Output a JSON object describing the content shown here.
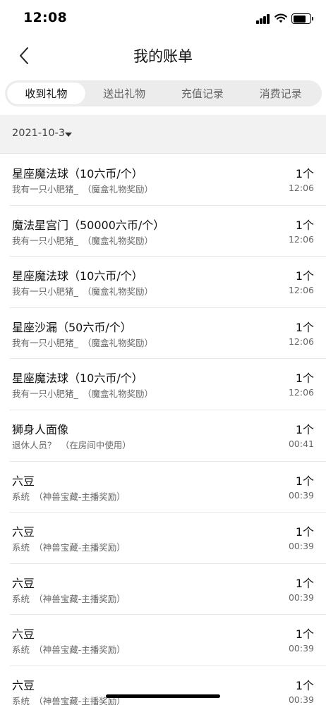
{
  "status_bar": {
    "time": "12:08"
  },
  "header": {
    "title": "我的账单"
  },
  "tabs": [
    {
      "label": "收到礼物",
      "active": true
    },
    {
      "label": "送出礼物",
      "active": false
    },
    {
      "label": "充值记录",
      "active": false
    },
    {
      "label": "消费记录",
      "active": false
    }
  ],
  "date_filter": {
    "value": "2021-10-3"
  },
  "records": [
    {
      "title": "星座魔法球（10六币/个）",
      "subtitle": "我有一只小肥猪_　（魔盒礼物奖励）",
      "count": "1个",
      "time": "12:06"
    },
    {
      "title": "魔法星宫门（50000六币/个）",
      "subtitle": "我有一只小肥猪_　（魔盒礼物奖励）",
      "count": "1个",
      "time": "12:06"
    },
    {
      "title": "星座魔法球（10六币/个）",
      "subtitle": "我有一只小肥猪_　（魔盒礼物奖励）",
      "count": "1个",
      "time": "12:06"
    },
    {
      "title": "星座沙漏（50六币/个）",
      "subtitle": "我有一只小肥猪_　（魔盒礼物奖励）",
      "count": "1个",
      "time": "12:06"
    },
    {
      "title": "星座魔法球（10六币/个）",
      "subtitle": "我有一只小肥猪_　（魔盒礼物奖励）",
      "count": "1个",
      "time": "12:06"
    },
    {
      "title": "狮身人面像",
      "subtitle": "退休人员？　（在房间中使用）",
      "count": "1个",
      "time": "00:41"
    },
    {
      "title": "六豆",
      "subtitle": "系统　（神兽宝藏-主播奖励）",
      "count": "1个",
      "time": "00:39"
    },
    {
      "title": "六豆",
      "subtitle": "系统　（神兽宝藏-主播奖励）",
      "count": "1个",
      "time": "00:39"
    },
    {
      "title": "六豆",
      "subtitle": "系统　（神兽宝藏-主播奖励）",
      "count": "1个",
      "time": "00:39"
    },
    {
      "title": "六豆",
      "subtitle": "系统　（神兽宝藏-主播奖励）",
      "count": "1个",
      "time": "00:39"
    },
    {
      "title": "六豆",
      "subtitle": "系统　（神兽宝藏-主播奖励）",
      "count": "1个",
      "time": "00:39"
    }
  ],
  "icons": {
    "back": "chevron-left-icon",
    "signal": "cellular-signal-icon",
    "wifi": "wifi-icon",
    "battery": "battery-icon",
    "date_dropdown": "caret-down-icon"
  },
  "colors": {
    "tab_track": "#ececec",
    "date_bar_bg": "#f2f2f2",
    "text_primary": "#111111",
    "text_secondary": "#666666"
  }
}
